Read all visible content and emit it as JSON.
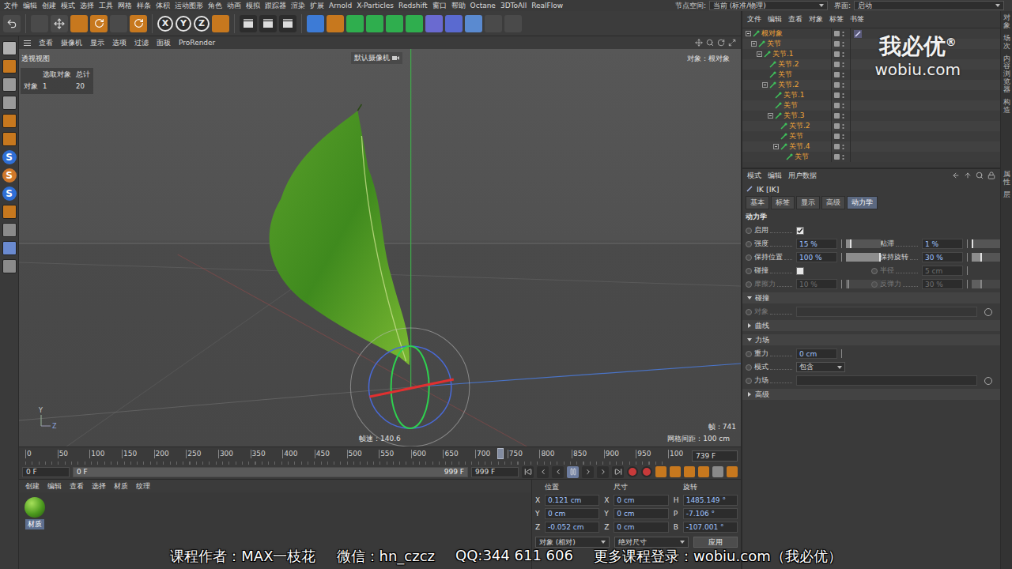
{
  "menu_bar": {
    "items": [
      "文件",
      "编辑",
      "创建",
      "模式",
      "选择",
      "工具",
      "网格",
      "样条",
      "体积",
      "运动图形",
      "角色",
      "动画",
      "模拟",
      "跟踪器",
      "渲染",
      "扩展",
      "Arnold",
      "X-Particles",
      "Redshift",
      "窗口",
      "帮助",
      "Octane",
      "3DToAll",
      "RealFlow"
    ],
    "node_space_label": "节点空间:",
    "node_space_value": "当前 (标准/物理)",
    "layout_label": "界面:",
    "layout_value": "启动"
  },
  "toolbar": {
    "axis_buttons": [
      {
        "label": "X",
        "selected": true
      },
      {
        "label": "Y",
        "selected": true
      },
      {
        "label": "Z",
        "selected": true
      }
    ]
  },
  "left_toolbar": {
    "letters": [
      "S",
      "S",
      "S"
    ]
  },
  "viewport": {
    "menu": [
      "查看",
      "摄像机",
      "显示",
      "选项",
      "过滤",
      "面板",
      "ProRender"
    ],
    "view_name": "透视视图",
    "hud": {
      "headers": [
        "选取对象",
        "总计"
      ],
      "row": [
        "对象",
        "1",
        "20"
      ]
    },
    "camera": "默认摄像机",
    "object_label": "对象：根对象",
    "fps": "帧速：140.6",
    "frame": "帧：741",
    "grid_spacing": "网格间距：100 cm",
    "axis_labels": [
      "Y",
      "Z"
    ]
  },
  "timeline": {
    "ticks": [
      "0",
      "50",
      "100",
      "150",
      "200",
      "250",
      "300",
      "350",
      "400",
      "450",
      "500",
      "550",
      "600",
      "650",
      "700",
      "750",
      "800",
      "850",
      "900",
      "950",
      "100"
    ],
    "playhead": 0.739,
    "current": "739 F"
  },
  "playback": {
    "start": "0 F",
    "range_start": "0 F",
    "range_end": "999 F",
    "end": "999 F",
    "playing": true
  },
  "material_manager": {
    "menu": [
      "创建",
      "编辑",
      "查看",
      "选择",
      "材质",
      "纹理"
    ],
    "materials": [
      {
        "name": "材质",
        "selected": true
      }
    ]
  },
  "coordinates": {
    "headers": [
      "位置",
      "尺寸",
      "旋转"
    ],
    "rows": [
      {
        "position_axis": "X",
        "position": "0.121 cm",
        "size_axis": "X",
        "size": "0 cm",
        "rotation_axis": "H",
        "rotation": "1485.149 °"
      },
      {
        "position_axis": "Y",
        "position": "0 cm",
        "size_axis": "Y",
        "size": "0 cm",
        "rotation_axis": "P",
        "rotation": "-7.106 °"
      },
      {
        "position_axis": "Z",
        "position": "-0.052 cm",
        "size_axis": "Z",
        "size": "0 cm",
        "rotation_axis": "B",
        "rotation": "-107.001 °"
      }
    ],
    "mode": "对象 (相对)",
    "size_mode": "绝对尺寸",
    "apply": "应用"
  },
  "object_manager": {
    "menu": [
      "文件",
      "编辑",
      "查看",
      "对象",
      "标签",
      "书签"
    ],
    "objects": [
      {
        "name": "根对象",
        "depth": 0,
        "children": true,
        "expanded": true,
        "selected": true,
        "has_tag": true
      },
      {
        "name": "关节",
        "depth": 1,
        "children": true,
        "expanded": true,
        "selected": true,
        "has_tag": false
      },
      {
        "name": "关节.1",
        "depth": 2,
        "children": true,
        "expanded": true,
        "selected": true,
        "has_tag": false
      },
      {
        "name": "关节.2",
        "depth": 3,
        "children": false,
        "expanded": false,
        "selected": true,
        "has_tag": false
      },
      {
        "name": "关节",
        "depth": 3,
        "children": false,
        "expanded": false,
        "selected": true,
        "has_tag": false
      },
      {
        "name": "关节.2",
        "depth": 3,
        "children": true,
        "expanded": true,
        "selected": true,
        "has_tag": false
      },
      {
        "name": "关节.1",
        "depth": 4,
        "children": false,
        "expanded": false,
        "selected": true,
        "has_tag": false
      },
      {
        "name": "关节",
        "depth": 4,
        "children": false,
        "expanded": false,
        "selected": true,
        "has_tag": false
      },
      {
        "name": "关节.3",
        "depth": 4,
        "children": true,
        "expanded": true,
        "selected": true,
        "has_tag": false
      },
      {
        "name": "关节.2",
        "depth": 5,
        "children": false,
        "expanded": false,
        "selected": true,
        "has_tag": false
      },
      {
        "name": "关节",
        "depth": 5,
        "children": false,
        "expanded": false,
        "selected": true,
        "has_tag": false
      },
      {
        "name": "关节.4",
        "depth": 5,
        "children": true,
        "expanded": true,
        "selected": true,
        "has_tag": false
      },
      {
        "name": "关节",
        "depth": 6,
        "children": false,
        "expanded": false,
        "selected": true,
        "has_tag": false
      }
    ]
  },
  "attribute_manager": {
    "menu": [
      "模式",
      "编辑",
      "用户数据"
    ],
    "title": "IK [IK]",
    "tabs": [
      {
        "label": "基本",
        "selected": false
      },
      {
        "label": "标签",
        "selected": false
      },
      {
        "label": "显示",
        "selected": false
      },
      {
        "label": "高级",
        "selected": false
      },
      {
        "label": "动力学",
        "selected": true
      }
    ],
    "section": "动力学",
    "rows": [
      [
        {
          "kind": "checkbox",
          "label": "启用",
          "checked": true,
          "disabled": false
        }
      ],
      [
        {
          "kind": "slider",
          "label": "强度",
          "value": "15 %",
          "level": 0.15,
          "disabled": false
        },
        {
          "kind": "slider",
          "label": "粘滞",
          "value": "1 %",
          "level": 0.01,
          "disabled": false
        }
      ],
      [
        {
          "kind": "slider",
          "label": "保持位置",
          "value": "100 %",
          "level": 1,
          "disabled": false
        },
        {
          "kind": "slider",
          "label": "保持旋转",
          "value": "30 %",
          "level": 0.3,
          "disabled": false
        }
      ],
      [
        {
          "kind": "checkbox",
          "label": "碰撞",
          "checked": false,
          "disabled": false
        },
        {
          "kind": "field",
          "label": "半径",
          "value": "5 cm",
          "disabled": true
        }
      ],
      [
        {
          "kind": "slider",
          "label": "摩擦力",
          "value": "10 %",
          "level": 0.1,
          "disabled": true
        },
        {
          "kind": "slider",
          "label": "反弹力",
          "value": "30 %",
          "level": 0.3,
          "disabled": true
        }
      ]
    ],
    "groups": [
      {
        "title": "碰撞",
        "expanded": true,
        "rows": [
          [
            {
              "kind": "link",
              "label": "对象",
              "disabled": true
            }
          ]
        ]
      },
      {
        "title": "曲线",
        "expanded": false,
        "rows": []
      },
      {
        "title": "力场",
        "expanded": true,
        "rows": [
          [
            {
              "kind": "field",
              "label": "重力",
              "value": "0 cm",
              "disabled": false
            }
          ],
          [
            {
              "kind": "dropdown",
              "label": "模式",
              "value": "包含",
              "disabled": false
            }
          ],
          [
            {
              "kind": "link",
              "label": "力场",
              "disabled": false
            }
          ]
        ]
      },
      {
        "title": "高级",
        "expanded": false,
        "rows": []
      }
    ]
  },
  "side_tabs": {
    "top": [
      "对象",
      "场次",
      "内容浏览器",
      "构造"
    ],
    "bottom": [
      "属性",
      "层"
    ]
  },
  "watermark": {
    "brand": "我必优",
    "mark": "®",
    "site": "wobiu.com"
  },
  "subtitle": [
    "课程作者：MAX一枝花",
    "微信：hn_czcz",
    "QQ:344 611 606",
    "更多课程登录：wobiu.com（我必优）"
  ]
}
